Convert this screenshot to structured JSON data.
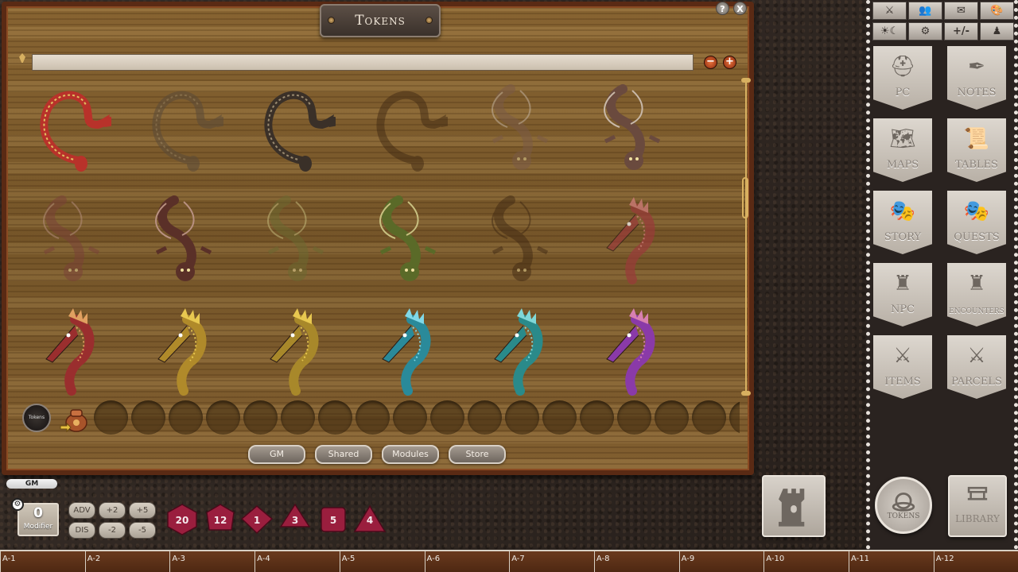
{
  "window": {
    "title": "Tokens",
    "help_label": "?",
    "close_label": "X",
    "zoom_out_label": "−",
    "zoom_in_label": "+",
    "filter_value": "",
    "tabs": [
      "GM",
      "Shared",
      "Modules",
      "Store"
    ],
    "tokens_coin_label": "Tokens"
  },
  "tokens": [
    {
      "kind": "serpent",
      "color": "#b8322a",
      "accent": "#e0c060",
      "opacity": 1
    },
    {
      "kind": "serpent",
      "color": "#5a4a38",
      "accent": "#8a7a60",
      "opacity": 0.55
    },
    {
      "kind": "serpent",
      "color": "#3a3028",
      "accent": "#9a8a70",
      "opacity": 1
    },
    {
      "kind": "serpent",
      "color": "#3a2410",
      "accent": "#3a2410",
      "opacity": 0.45
    },
    {
      "kind": "wyrm",
      "color": "#7a5a48",
      "accent": "#c8b8a8",
      "opacity": 0.5
    },
    {
      "kind": "wyrm",
      "color": "#6a4a3e",
      "accent": "#c8b8a8",
      "opacity": 1
    },
    {
      "kind": "wyrm",
      "color": "#7a4038",
      "accent": "#b89080",
      "opacity": 0.5
    },
    {
      "kind": "wyrm",
      "color": "#5a3028",
      "accent": "#b89080",
      "opacity": 1
    },
    {
      "kind": "wyrm",
      "color": "#6a6a30",
      "accent": "#c8c080",
      "opacity": 0.5
    },
    {
      "kind": "wyrm",
      "color": "#5a6a28",
      "accent": "#c8c080",
      "opacity": 1
    },
    {
      "kind": "wyrm",
      "color": "#3a2410",
      "accent": "#3a2410",
      "opacity": 0.45
    },
    {
      "kind": "seahorse",
      "color": "#9a3a3a",
      "accent": "#d88080",
      "opacity": 0.7
    },
    {
      "kind": "seahorse",
      "color": "#9a2e2e",
      "accent": "#e0a060",
      "opacity": 1
    },
    {
      "kind": "seahorse",
      "color": "#b08a2a",
      "accent": "#e8c850",
      "opacity": 1
    },
    {
      "kind": "seahorse",
      "color": "#a8882a",
      "accent": "#e8c850",
      "opacity": 1
    },
    {
      "kind": "seahorse",
      "color": "#2a8a9a",
      "accent": "#80d8e8",
      "opacity": 1
    },
    {
      "kind": "seahorse",
      "color": "#2a8a8a",
      "accent": "#80d8d8",
      "opacity": 1
    },
    {
      "kind": "seahorse",
      "color": "#8a3aa8",
      "accent": "#d880b0",
      "opacity": 1
    }
  ],
  "sidebar": {
    "tool_row_1": [
      "⚔",
      "👥",
      "✉",
      "🎨"
    ],
    "tool_row_2": [
      "☀☾",
      "⚙",
      "+/-",
      "♟"
    ],
    "banners": [
      {
        "label": "PC",
        "icon": "helmet-icon",
        "glyph": "⛑"
      },
      {
        "label": "NOTES",
        "icon": "quill-icon",
        "glyph": "✒"
      },
      {
        "label": "MAPS",
        "icon": "map-icon",
        "glyph": "🗺"
      },
      {
        "label": "TABLES",
        "icon": "scroll-icon",
        "glyph": "📜"
      },
      {
        "label": "STORY",
        "icon": "masks-icon",
        "glyph": "🎭"
      },
      {
        "label": "QUESTS",
        "icon": "masks-icon",
        "glyph": "🎭"
      },
      {
        "label": "NPC",
        "icon": "horned-helm-icon",
        "glyph": "♜"
      },
      {
        "label": "ENCOUNTERS",
        "icon": "horned-helm-icon",
        "glyph": "♜"
      },
      {
        "label": "ITEMS",
        "icon": "armor-sword-icon",
        "glyph": "⚔"
      },
      {
        "label": "PARCELS",
        "icon": "armor-sword-icon",
        "glyph": "⚔"
      }
    ],
    "tokens_button_label": "TOKENS",
    "library_button_label": "LIBRARY"
  },
  "bottom": {
    "chat_tab_label": "GM",
    "modifier_value": "0",
    "modifier_label": "Modifier",
    "mod_buttons_top": [
      "ADV",
      "+2",
      "+5"
    ],
    "mod_buttons_bottom": [
      "DIS",
      "-2",
      "-5"
    ],
    "dice": [
      {
        "type": "d20",
        "face": "20"
      },
      {
        "type": "d12",
        "face": "12"
      },
      {
        "type": "d10",
        "face": "1"
      },
      {
        "type": "d8",
        "face": "3"
      },
      {
        "type": "d6",
        "face": "5"
      },
      {
        "type": "d4",
        "face": "4"
      }
    ],
    "dice_color": "#9a1e3e"
  },
  "ruler": [
    "A-1",
    "A-2",
    "A-3",
    "A-4",
    "A-5",
    "A-6",
    "A-7",
    "A-8",
    "A-9",
    "A-10",
    "A-11",
    "A-12"
  ]
}
